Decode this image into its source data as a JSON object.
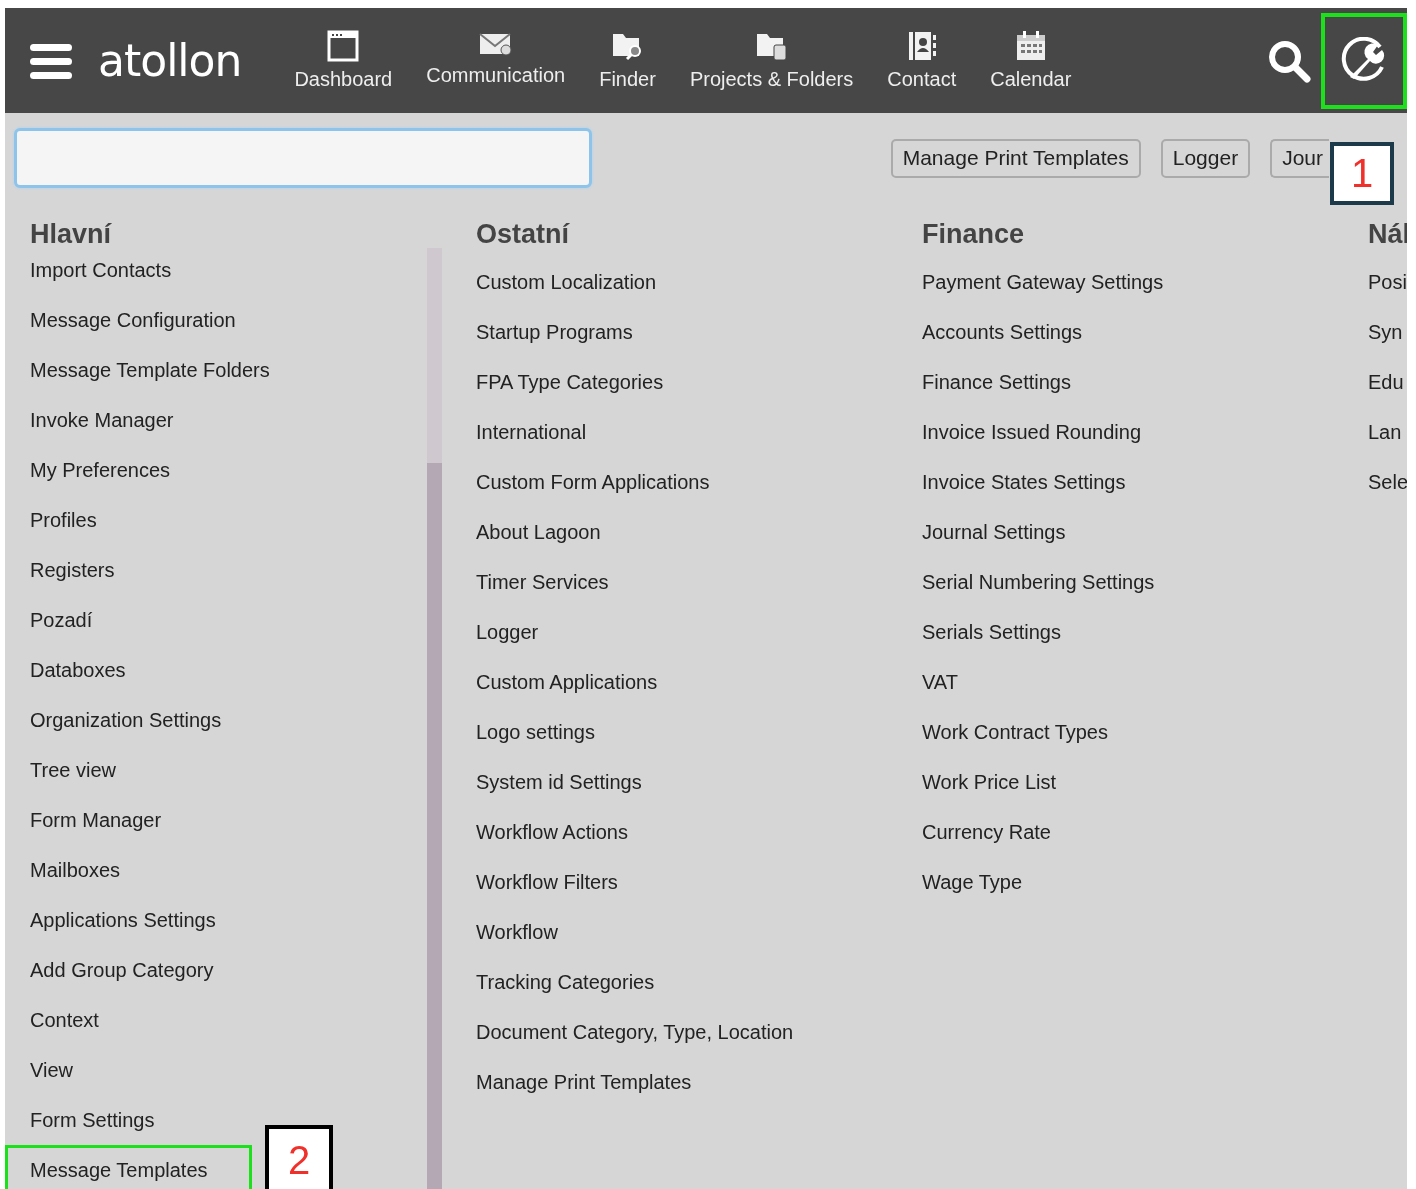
{
  "top_bar": {
    "logo": "atollon",
    "nav": [
      {
        "label": "Dashboard",
        "kind": "window"
      },
      {
        "label": "Communication",
        "kind": "mail"
      },
      {
        "label": "Finder",
        "kind": "finder"
      },
      {
        "label": "Projects & Folders",
        "kind": "projects"
      },
      {
        "label": "Contact",
        "kind": "contact"
      },
      {
        "label": "Calendar",
        "kind": "calendar"
      }
    ],
    "settings_highlighted": true
  },
  "quick_buttons": [
    "Manage Print Templates",
    "Logger",
    "Jour"
  ],
  "columns": [
    {
      "title": "Hlavní",
      "scrollbar": true,
      "items": [
        {
          "label": "Import Contacts",
          "highlighted": false
        },
        {
          "label": "Message Configuration",
          "highlighted": false
        },
        {
          "label": "Message Template Folders",
          "highlighted": false
        },
        {
          "label": "Invoke Manager",
          "highlighted": false
        },
        {
          "label": "My Preferences",
          "highlighted": false
        },
        {
          "label": "Profiles",
          "highlighted": false
        },
        {
          "label": "Registers",
          "highlighted": false
        },
        {
          "label": "Pozadí",
          "highlighted": false
        },
        {
          "label": "Databoxes",
          "highlighted": false
        },
        {
          "label": "Organization Settings",
          "highlighted": false
        },
        {
          "label": "Tree view",
          "highlighted": false
        },
        {
          "label": "Form Manager",
          "highlighted": false
        },
        {
          "label": "Mailboxes",
          "highlighted": false
        },
        {
          "label": "Applications Settings",
          "highlighted": false
        },
        {
          "label": "Add Group Category",
          "highlighted": false
        },
        {
          "label": "Context",
          "highlighted": false
        },
        {
          "label": "View",
          "highlighted": false
        },
        {
          "label": "Form Settings",
          "highlighted": false
        },
        {
          "label": "Message Templates",
          "highlighted": true
        }
      ]
    },
    {
      "title": "Ostatní",
      "scrollbar": false,
      "items": [
        {
          "label": "Custom Localization",
          "highlighted": false
        },
        {
          "label": "Startup Programs",
          "highlighted": false
        },
        {
          "label": "FPA Type Categories",
          "highlighted": false
        },
        {
          "label": "International",
          "highlighted": false
        },
        {
          "label": "Custom Form Applications",
          "highlighted": false
        },
        {
          "label": "About Lagoon",
          "highlighted": false
        },
        {
          "label": "Timer Services",
          "highlighted": false
        },
        {
          "label": "Logger",
          "highlighted": false
        },
        {
          "label": "Custom Applications",
          "highlighted": false
        },
        {
          "label": "Logo settings",
          "highlighted": false
        },
        {
          "label": "System id Settings",
          "highlighted": false
        },
        {
          "label": "Workflow Actions",
          "highlighted": false
        },
        {
          "label": "Workflow Filters",
          "highlighted": false
        },
        {
          "label": "Workflow",
          "highlighted": false
        },
        {
          "label": "Tracking Categories",
          "highlighted": false
        },
        {
          "label": "Document Category, Type, Location",
          "highlighted": false
        },
        {
          "label": "Manage Print Templates",
          "highlighted": false
        }
      ]
    },
    {
      "title": "Finance",
      "scrollbar": false,
      "items": [
        {
          "label": "Payment Gateway Settings",
          "highlighted": false
        },
        {
          "label": "Accounts Settings",
          "highlighted": false
        },
        {
          "label": "Finance Settings",
          "highlighted": false
        },
        {
          "label": "Invoice Issued Rounding",
          "highlighted": false
        },
        {
          "label": "Invoice States Settings",
          "highlighted": false
        },
        {
          "label": "Journal Settings",
          "highlighted": false
        },
        {
          "label": "Serial Numbering Settings",
          "highlighted": false
        },
        {
          "label": "Serials Settings",
          "highlighted": false
        },
        {
          "label": "VAT",
          "highlighted": false
        },
        {
          "label": "Work Contract Types",
          "highlighted": false
        },
        {
          "label": "Work Price List",
          "highlighted": false
        },
        {
          "label": "Currency Rate",
          "highlighted": false
        },
        {
          "label": "Wage Type",
          "highlighted": false
        }
      ]
    },
    {
      "title": "Nál",
      "scrollbar": false,
      "items": [
        {
          "label": "Posi",
          "highlighted": false
        },
        {
          "label": "Syn",
          "highlighted": false
        },
        {
          "label": "Edu",
          "highlighted": false
        },
        {
          "label": "Lan",
          "highlighted": false
        },
        {
          "label": "Sele",
          "highlighted": false
        }
      ]
    }
  ],
  "callouts": [
    {
      "label": "1"
    },
    {
      "label": "2"
    }
  ]
}
